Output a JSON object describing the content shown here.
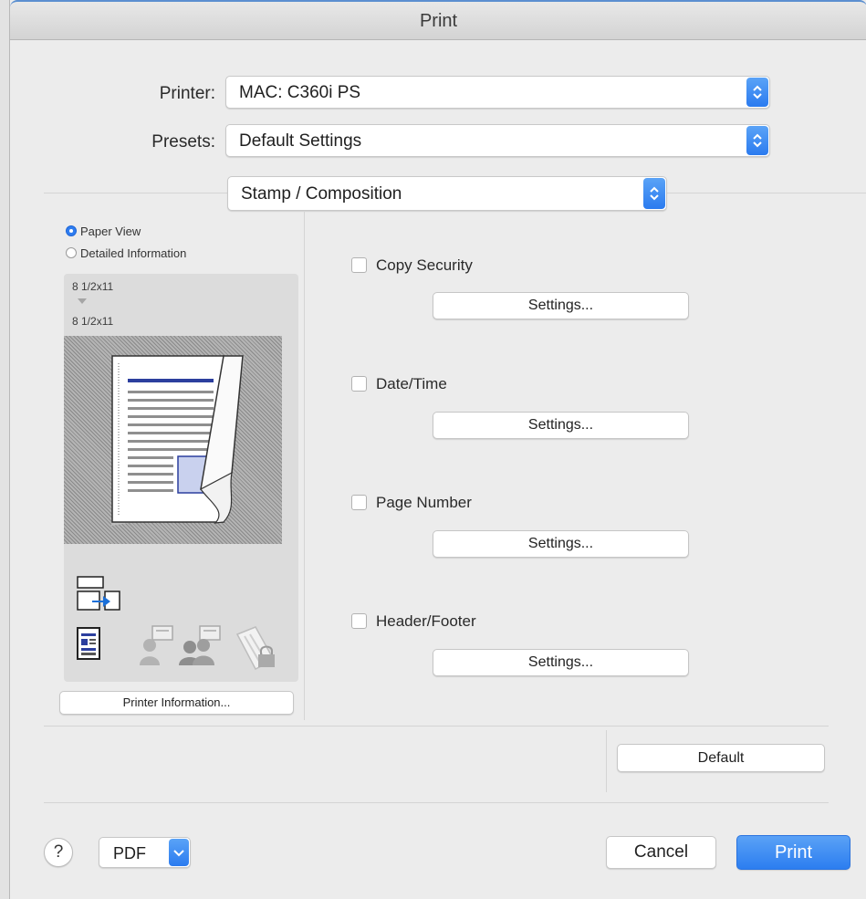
{
  "window": {
    "title": "Print"
  },
  "printer": {
    "label": "Printer:",
    "value": "MAC: C360i PS"
  },
  "presets": {
    "label": "Presets:",
    "value": "Default Settings"
  },
  "panel": {
    "value": "Stamp / Composition"
  },
  "view_mode": {
    "options": [
      {
        "label": "Paper View",
        "selected": true
      },
      {
        "label": "Detailed Information",
        "selected": false
      }
    ]
  },
  "preview": {
    "source_size": "8 1/2x11",
    "output_size": "8 1/2x11",
    "printer_info_button": "Printer Information..."
  },
  "stamps": [
    {
      "label": "Copy Security",
      "checked": false,
      "settings_label": "Settings..."
    },
    {
      "label": "Date/Time",
      "checked": false,
      "settings_label": "Settings..."
    },
    {
      "label": "Page Number",
      "checked": false,
      "settings_label": "Settings..."
    },
    {
      "label": "Header/Footer",
      "checked": false,
      "settings_label": "Settings..."
    }
  ],
  "default_button": "Default",
  "footer": {
    "help_label": "?",
    "pdf_label": "PDF",
    "cancel_label": "Cancel",
    "print_label": "Print"
  },
  "colors": {
    "accent": "#2e7cf0",
    "doc_blue": "#2c3f9e"
  }
}
